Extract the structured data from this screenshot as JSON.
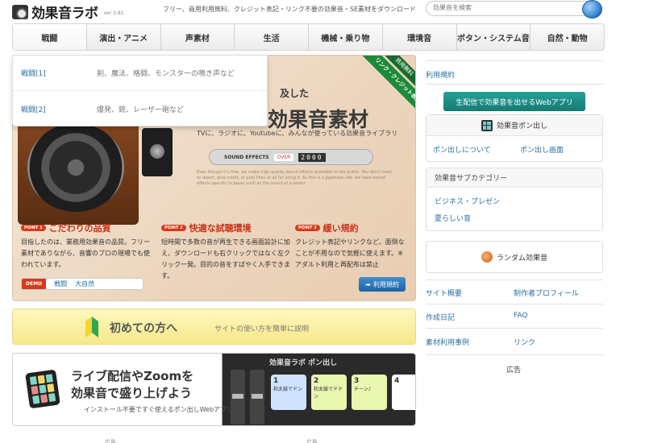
{
  "header": {
    "logo_text": "効果音ラボ",
    "version": "ver 3.81",
    "tagline": "フリー、商用利用無料、クレジット表記・リンク不要の効果音・SE素材をダウンロード",
    "search_placeholder": "効果音を検索"
  },
  "nav": {
    "items": [
      "戦闘",
      "演出・アニメ",
      "声素材",
      "生活",
      "機械・乗り物",
      "環境音",
      "ボタン・システム音",
      "自然・動物"
    ]
  },
  "dropdown": {
    "items": [
      {
        "name": "戦闘[1]",
        "desc": "剣、魔法、格闘、モンスターの鳴き声など"
      },
      {
        "name": "戦闘[2]",
        "desc": "爆発、銃、レーザー砲など"
      }
    ]
  },
  "hero": {
    "title_pre": "及した",
    "title": "効果音素材",
    "subtitle": "TVに、ラジオに、Youtubeに、みんなが使っている効果音ライブラリ",
    "ribbon_main": "リンク・クレジット表記不要",
    "ribbon_top": "商用無料",
    "sfx_label": "SOUND EFFECTS",
    "sfx_over": "OVER",
    "sfx_count": "2000",
    "fine_print": "Even though it's free, we make high quality sound effects available to the public. You don't need to report, give credit, or post links at all for using it. As this is a Japanese site, we have sound effects specific to Japan such as the sound of a sword",
    "points": [
      {
        "badge": "POINT 1",
        "title": "こだわりの品質",
        "body": "目指したのは、業務用効果音の品質。フリー素材でありながら、音響のプロの現場でも使われています。"
      },
      {
        "badge": "POINT 2",
        "title": "快適な試聴環境",
        "body": "短時間で多数の音が再生できる画面設計に加え、ダウンロードも右クリックではなく左クリック一発。目的の音をすばやく入手できます。"
      },
      {
        "badge": "POINT 3",
        "title": "緩い規約",
        "body": "クレジット表記やリンクなど、面倒なことが不用なので気軽に使えます。※アダルト利用と再配布は禁止"
      }
    ],
    "demo_tag": "DEMO",
    "demo_links": [
      "戦闘",
      "大自然"
    ],
    "terms_button": "利用規約"
  },
  "banner_beginner": {
    "title": "初めての方へ",
    "subtitle": "サイトの使い方を簡単に説明"
  },
  "banner_live": {
    "line1": "ライブ配信やZoomを",
    "line2": "効果音で盛り上げよう",
    "sub": "インストール不要ですぐ使えるポン出しWebアプリ",
    "app_title": "効果音ラボ ポン出し",
    "pads": [
      {
        "num": "1",
        "label": "和太鼓でドン",
        "color": "#cfe3ff"
      },
      {
        "num": "2",
        "label": "和太鼓でドドン",
        "color": "#e9f6b0"
      },
      {
        "num": "3",
        "label": "チーン♪",
        "color": "#e9f6b0"
      },
      {
        "num": "4",
        "label": "",
        "color": "#ffffff"
      }
    ]
  },
  "footnotes": [
    "広告",
    "広告"
  ],
  "sidebar": {
    "terms_link": "利用規約",
    "stream_button": "生配信で効果音を出せるWebアプリ",
    "ponedashi_title": "効果音ポン出し",
    "ponedashi_links": [
      "ポン出しについて",
      "ポン出し画面"
    ],
    "subcategory_title": "効果音サブカテゴリー",
    "subcategory_links": [
      "ビジネス・プレゼン",
      "夏らしい音"
    ],
    "random_label": "ランダム効果音",
    "footer_links": [
      [
        "サイト概要",
        "制作者プロフィール"
      ],
      [
        "作成日記",
        "FAQ"
      ],
      [
        "素材利用事例",
        "リンク"
      ]
    ],
    "ad_label": "広告"
  }
}
